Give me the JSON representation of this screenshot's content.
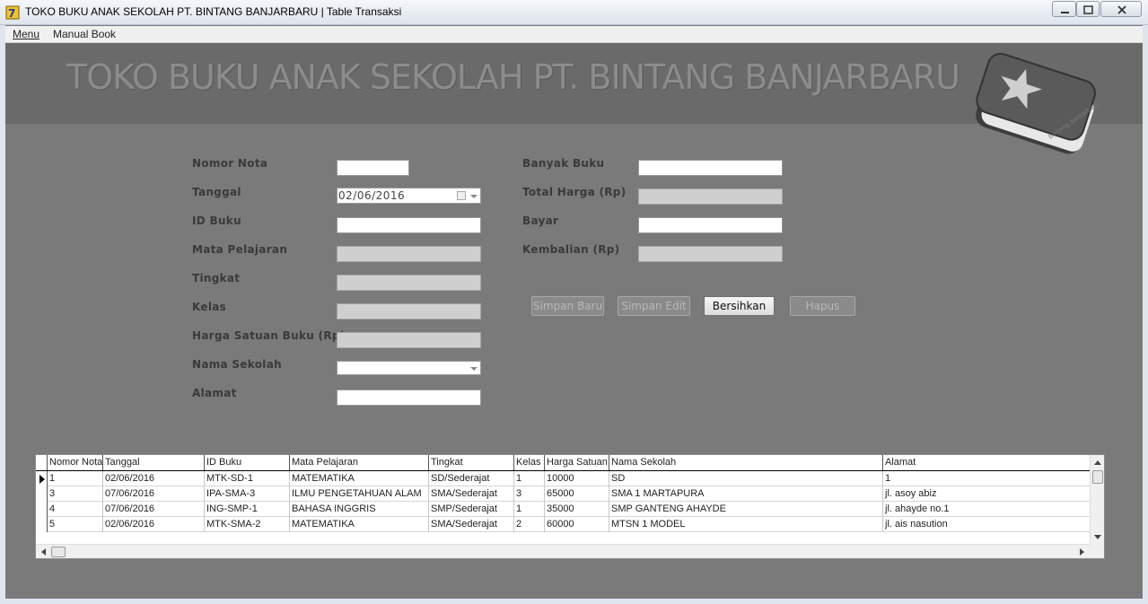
{
  "window": {
    "title": "TOKO BUKU ANAK SEKOLAH PT. BINTANG BANJARBARU | Table Transaksi"
  },
  "menubar": {
    "items": [
      {
        "label": "Menu"
      },
      {
        "label": "Manual Book"
      }
    ]
  },
  "banner": {
    "title": "TOKO BUKU ANAK SEKOLAH PT. BINTANG BANJARBARU",
    "logo_text": "bintang banjarbaru"
  },
  "form_left": {
    "nomor_nota": {
      "label": "Nomor Nota",
      "value": ""
    },
    "tanggal": {
      "label": "Tanggal",
      "value": "02/06/2016"
    },
    "id_buku": {
      "label": "ID Buku",
      "value": ""
    },
    "mata_pelajaran": {
      "label": "Mata Pelajaran",
      "value": ""
    },
    "tingkat": {
      "label": "Tingkat",
      "value": ""
    },
    "kelas": {
      "label": "Kelas",
      "value": ""
    },
    "harga_satuan": {
      "label": "Harga Satuan Buku (Rp)",
      "value": ""
    },
    "nama_sekolah": {
      "label": "Nama Sekolah",
      "value": ""
    },
    "alamat": {
      "label": "Alamat",
      "value": ""
    }
  },
  "form_right": {
    "banyak_buku": {
      "label": "Banyak Buku",
      "value": ""
    },
    "total_harga": {
      "label": "Total Harga (Rp)",
      "value": ""
    },
    "bayar": {
      "label": "Bayar",
      "value": ""
    },
    "kembalian": {
      "label": "Kembalian (Rp)",
      "value": ""
    }
  },
  "buttons": {
    "simpan_baru": "Simpan Baru",
    "simpan_edit": "Simpan Edit",
    "bersihkan": "Bersihkan",
    "hapus": "Hapus"
  },
  "table": {
    "columns": [
      "Nomor Nota",
      "Tanggal",
      "ID Buku",
      "Mata Pelajaran",
      "Tingkat",
      "Kelas",
      "Harga Satuan",
      "Nama Sekolah",
      "Alamat"
    ],
    "rows": [
      [
        "1",
        "02/06/2016",
        "MTK-SD-1",
        "MATEMATIKA",
        "SD/Sederajat",
        "1",
        "10000",
        "SD",
        "1"
      ],
      [
        "3",
        "07/06/2016",
        "IPA-SMA-3",
        "ILMU PENGETAHUAN ALAM",
        "SMA/Sederajat",
        "3",
        "65000",
        "SMA 1 MARTAPURA",
        "jl. asoy abiz"
      ],
      [
        "4",
        "07/06/2016",
        "ING-SMP-1",
        "BAHASA INGGRIS",
        "SMP/Sederajat",
        "1",
        "35000",
        "SMP GANTENG AHAYDE",
        "jl. ahayde no.1"
      ],
      [
        "5",
        "02/06/2016",
        "MTK-SMA-2",
        "MATEMATIKA",
        "SMA/Sederajat",
        "2",
        "60000",
        "MTSN 1 MODEL",
        "jl. ais nasution"
      ]
    ]
  }
}
